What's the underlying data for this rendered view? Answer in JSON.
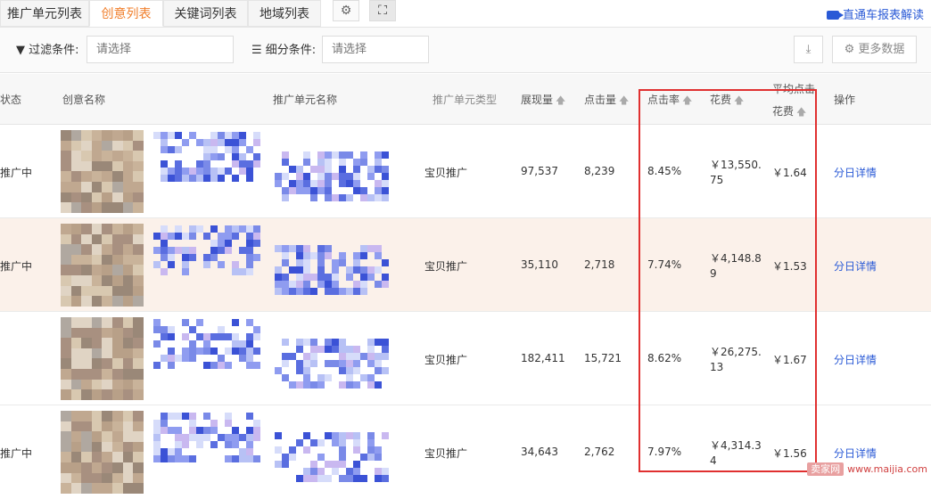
{
  "tabs": [
    {
      "label": "推广单元列表",
      "active": false
    },
    {
      "label": "创意列表",
      "active": true
    },
    {
      "label": "关键词列表",
      "active": false
    },
    {
      "label": "地域列表",
      "active": false
    }
  ],
  "tab_icons": [
    "gear-icon",
    "expand-icon"
  ],
  "help_link": "直通车报表解读",
  "filters": {
    "filter_label": "过滤条件:",
    "filter_placeholder": "请选择",
    "segment_label": "细分条件:",
    "segment_placeholder": "请选择",
    "more_data_label": "更多数据"
  },
  "columns": {
    "status": "状态",
    "creative_name": "创意名称",
    "unit_name": "推广单元名称",
    "unit_type": "推广单元类型",
    "impressions": "展现量",
    "clicks": "点击量",
    "ctr": "点击率",
    "cost": "花费",
    "avg_cpc_line1": "平均点击",
    "avg_cpc_line2": "花费",
    "action": "操作"
  },
  "rows": [
    {
      "status": "推广中",
      "unit_type": "宝贝推广",
      "impressions": "97,537",
      "clicks": "8,239",
      "ctr": "8.45%",
      "cost_line1": "￥13,550.",
      "cost_line2": "75",
      "avg_cpc": "￥1.64",
      "action": "分日详情"
    },
    {
      "status": "推广中",
      "unit_type": "宝贝推广",
      "impressions": "35,110",
      "clicks": "2,718",
      "ctr": "7.74%",
      "cost_line1": "￥4,148.8",
      "cost_line2": "9",
      "avg_cpc": "￥1.53",
      "action": "分日详情"
    },
    {
      "status": "",
      "unit_type": "宝贝推广",
      "impressions": "182,411",
      "clicks": "15,721",
      "ctr": "8.62%",
      "cost_line1": "￥26,275.",
      "cost_line2": "13",
      "avg_cpc": "￥1.67",
      "action": "分日详情"
    },
    {
      "status": "推广中",
      "unit_type": "宝贝推广",
      "impressions": "34,643",
      "clicks": "2,762",
      "ctr": "7.97%",
      "cost_line1": "￥4,314.3",
      "cost_line2": "4",
      "avg_cpc": "￥1.56",
      "action": "分日详情"
    }
  ],
  "highlight_color": "#e03030",
  "accent_color": "#f07e2a",
  "link_color": "#2a5ad6",
  "watermark": {
    "logo": "卖家网",
    "url": "www.maijia.com"
  }
}
